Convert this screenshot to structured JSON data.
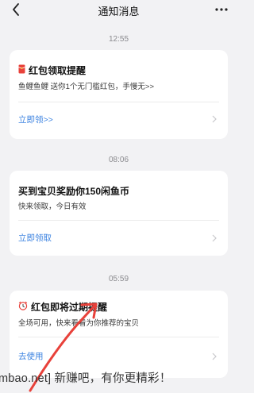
{
  "header": {
    "title": "通知消息"
  },
  "messages": [
    {
      "time": "12:55",
      "title": "红包领取提醒",
      "desc": "鱼鲤鱼鲤 送你1个无门槛红包，手慢无>>",
      "action": "立即领>>"
    },
    {
      "time": "08:06",
      "title": "买到宝贝奖励你150闲鱼币",
      "desc": "快来领取，今日有效",
      "action": "立即领取"
    },
    {
      "time": "05:59",
      "title": "红包即将过期提醒",
      "desc": "全场可用，快来看看为你推荐的宝贝",
      "action": "去使用"
    }
  ],
  "overlay_text": "mbao.net] 新赚吧，有你更精彩！",
  "colors": {
    "accent_blue": "#3b82e0",
    "annotation_red": "#e8413a",
    "background": "#f2f2f4"
  }
}
